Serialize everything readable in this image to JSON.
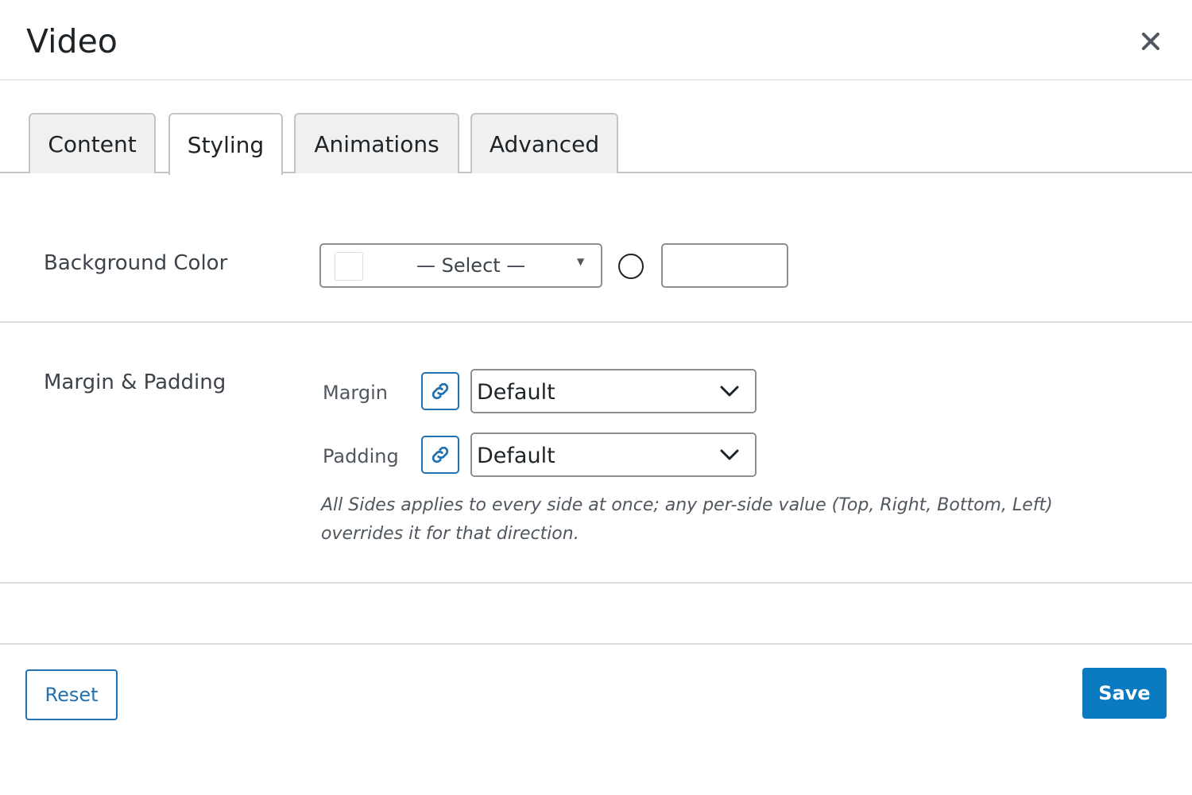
{
  "dialog": {
    "title": "Video",
    "close_icon": "close-icon"
  },
  "tabs": [
    {
      "label": "Content",
      "active": false
    },
    {
      "label": "Styling",
      "active": true
    },
    {
      "label": "Animations",
      "active": false
    },
    {
      "label": "Advanced",
      "active": false
    }
  ],
  "background_color": {
    "label": "Background Color",
    "select_text": "— Select —",
    "opacity_value": ""
  },
  "margin_padding": {
    "label": "Margin & Padding",
    "margin_label": "Margin",
    "margin_value": "Default",
    "padding_label": "Padding",
    "padding_value": "Default",
    "link_icon": "link-icon",
    "help_text": "All Sides applies to every side at once; any per-side value (Top, Right, Bottom, Left) overrides it for that direction."
  },
  "footer": {
    "reset_label": "Reset",
    "save_label": "Save"
  },
  "colors": {
    "accent": "#2271b1",
    "save_bg": "#0a7bc1"
  }
}
